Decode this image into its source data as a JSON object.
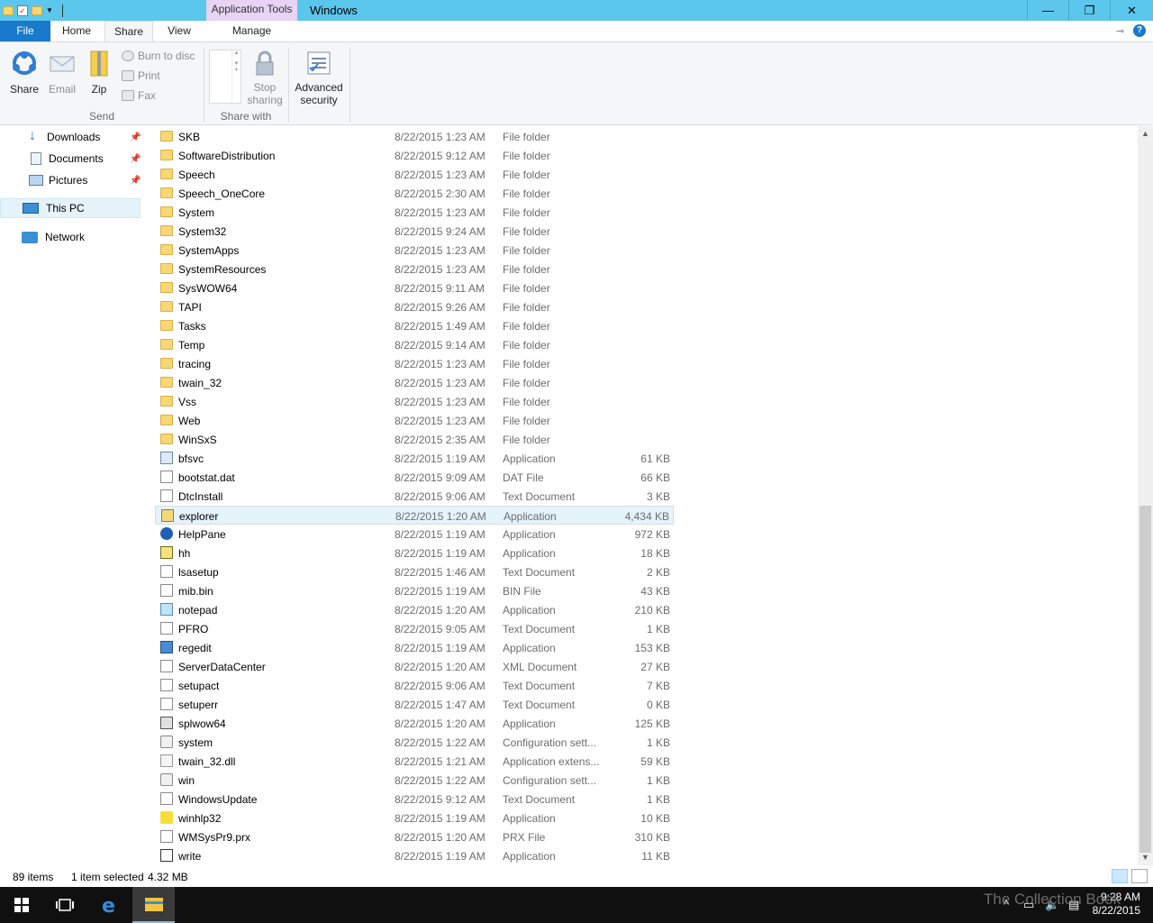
{
  "window": {
    "title": "Windows",
    "context_tab": "Application Tools"
  },
  "tabs": {
    "file": "File",
    "home": "Home",
    "share": "Share",
    "view": "View",
    "manage": "Manage"
  },
  "ribbon": {
    "share": "Share",
    "email": "Email",
    "zip": "Zip",
    "burn": "Burn to disc",
    "print": "Print",
    "fax": "Fax",
    "send_group": "Send",
    "stop_sharing_1": "Stop",
    "stop_sharing_2": "sharing",
    "share_with_group": "Share with",
    "advanced_1": "Advanced",
    "advanced_2": "security"
  },
  "nav": {
    "downloads": "Downloads",
    "documents": "Documents",
    "pictures": "Pictures",
    "this_pc": "This PC",
    "network": "Network"
  },
  "files": [
    {
      "name": "SKB",
      "date": "8/22/2015 1:23 AM",
      "type": "File folder",
      "size": "",
      "icon": "folder"
    },
    {
      "name": "SoftwareDistribution",
      "date": "8/22/2015 9:12 AM",
      "type": "File folder",
      "size": "",
      "icon": "folder"
    },
    {
      "name": "Speech",
      "date": "8/22/2015 1:23 AM",
      "type": "File folder",
      "size": "",
      "icon": "folder"
    },
    {
      "name": "Speech_OneCore",
      "date": "8/22/2015 2:30 AM",
      "type": "File folder",
      "size": "",
      "icon": "folder"
    },
    {
      "name": "System",
      "date": "8/22/2015 1:23 AM",
      "type": "File folder",
      "size": "",
      "icon": "folder"
    },
    {
      "name": "System32",
      "date": "8/22/2015 9:24 AM",
      "type": "File folder",
      "size": "",
      "icon": "folder"
    },
    {
      "name": "SystemApps",
      "date": "8/22/2015 1:23 AM",
      "type": "File folder",
      "size": "",
      "icon": "folder"
    },
    {
      "name": "SystemResources",
      "date": "8/22/2015 1:23 AM",
      "type": "File folder",
      "size": "",
      "icon": "folder"
    },
    {
      "name": "SysWOW64",
      "date": "8/22/2015 9:11 AM",
      "type": "File folder",
      "size": "",
      "icon": "folder"
    },
    {
      "name": "TAPI",
      "date": "8/22/2015 9:26 AM",
      "type": "File folder",
      "size": "",
      "icon": "folder"
    },
    {
      "name": "Tasks",
      "date": "8/22/2015 1:49 AM",
      "type": "File folder",
      "size": "",
      "icon": "folder"
    },
    {
      "name": "Temp",
      "date": "8/22/2015 9:14 AM",
      "type": "File folder",
      "size": "",
      "icon": "folder"
    },
    {
      "name": "tracing",
      "date": "8/22/2015 1:23 AM",
      "type": "File folder",
      "size": "",
      "icon": "folder"
    },
    {
      "name": "twain_32",
      "date": "8/22/2015 1:23 AM",
      "type": "File folder",
      "size": "",
      "icon": "folder"
    },
    {
      "name": "Vss",
      "date": "8/22/2015 1:23 AM",
      "type": "File folder",
      "size": "",
      "icon": "folder"
    },
    {
      "name": "Web",
      "date": "8/22/2015 1:23 AM",
      "type": "File folder",
      "size": "",
      "icon": "folder"
    },
    {
      "name": "WinSxS",
      "date": "8/22/2015 2:35 AM",
      "type": "File folder",
      "size": "",
      "icon": "folder"
    },
    {
      "name": "bfsvc",
      "date": "8/22/2015 1:19 AM",
      "type": "Application",
      "size": "61 KB",
      "icon": "app"
    },
    {
      "name": "bootstat.dat",
      "date": "8/22/2015 9:09 AM",
      "type": "DAT File",
      "size": "66 KB",
      "icon": "doc"
    },
    {
      "name": "DtcInstall",
      "date": "8/22/2015 9:06 AM",
      "type": "Text Document",
      "size": "3 KB",
      "icon": "doc"
    },
    {
      "name": "explorer",
      "date": "8/22/2015 1:20 AM",
      "type": "Application",
      "size": "4,434 KB",
      "icon": "exp",
      "selected": true
    },
    {
      "name": "HelpPane",
      "date": "8/22/2015 1:19 AM",
      "type": "Application",
      "size": "972 KB",
      "icon": "help"
    },
    {
      "name": "hh",
      "date": "8/22/2015 1:19 AM",
      "type": "Application",
      "size": "18 KB",
      "icon": "hh"
    },
    {
      "name": "lsasetup",
      "date": "8/22/2015 1:46 AM",
      "type": "Text Document",
      "size": "2 KB",
      "icon": "doc"
    },
    {
      "name": "mib.bin",
      "date": "8/22/2015 1:19 AM",
      "type": "BIN File",
      "size": "43 KB",
      "icon": "doc"
    },
    {
      "name": "notepad",
      "date": "8/22/2015 1:20 AM",
      "type": "Application",
      "size": "210 KB",
      "icon": "note"
    },
    {
      "name": "PFRO",
      "date": "8/22/2015 9:05 AM",
      "type": "Text Document",
      "size": "1 KB",
      "icon": "doc"
    },
    {
      "name": "regedit",
      "date": "8/22/2015 1:19 AM",
      "type": "Application",
      "size": "153 KB",
      "icon": "reg"
    },
    {
      "name": "ServerDataCenter",
      "date": "8/22/2015 1:20 AM",
      "type": "XML Document",
      "size": "27 KB",
      "icon": "doc"
    },
    {
      "name": "setupact",
      "date": "8/22/2015 9:06 AM",
      "type": "Text Document",
      "size": "7 KB",
      "icon": "doc"
    },
    {
      "name": "setuperr",
      "date": "8/22/2015 1:47 AM",
      "type": "Text Document",
      "size": "0 KB",
      "icon": "doc"
    },
    {
      "name": "splwow64",
      "date": "8/22/2015 1:20 AM",
      "type": "Application",
      "size": "125 KB",
      "icon": "print"
    },
    {
      "name": "system",
      "date": "8/22/2015 1:22 AM",
      "type": "Configuration sett...",
      "size": "1 KB",
      "icon": "cfg"
    },
    {
      "name": "twain_32.dll",
      "date": "8/22/2015 1:21 AM",
      "type": "Application extens...",
      "size": "59 KB",
      "icon": "dll"
    },
    {
      "name": "win",
      "date": "8/22/2015 1:22 AM",
      "type": "Configuration sett...",
      "size": "1 KB",
      "icon": "cfg"
    },
    {
      "name": "WindowsUpdate",
      "date": "8/22/2015 9:12 AM",
      "type": "Text Document",
      "size": "1 KB",
      "icon": "doc"
    },
    {
      "name": "winhlp32",
      "date": "8/22/2015 1:19 AM",
      "type": "Application",
      "size": "10 KB",
      "icon": "yq"
    },
    {
      "name": "WMSysPr9.prx",
      "date": "8/22/2015 1:20 AM",
      "type": "PRX File",
      "size": "310 KB",
      "icon": "doc"
    },
    {
      "name": "write",
      "date": "8/22/2015 1:19 AM",
      "type": "Application",
      "size": "11 KB",
      "icon": "write"
    }
  ],
  "status": {
    "count": "89 items",
    "selected": "1 item selected",
    "size": "4.32 MB"
  },
  "taskbar": {
    "time": "9:28 AM",
    "date": "8/22/2015"
  },
  "watermark": "The Collection Book"
}
